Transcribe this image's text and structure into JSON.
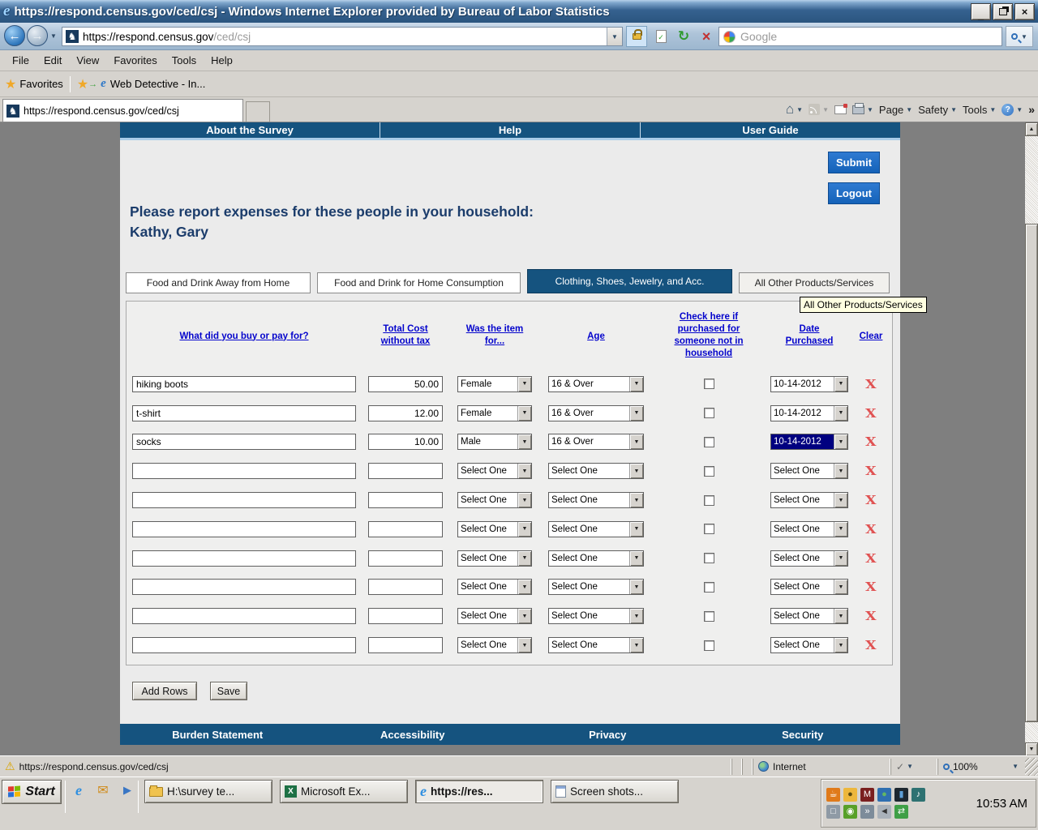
{
  "glyphs": {
    "caret": "▼",
    "up": "▲",
    "back": "←",
    "forward": "→",
    "refresh": "↻",
    "stop": "×",
    "close": "×",
    "minimize": "_",
    "home": "⌂",
    "star": "★",
    "fav_arrow": "→",
    "knight": "♞",
    "warning": "⚠",
    "chevrons": "»",
    "help": "?",
    "check": "✓",
    "clear": "X",
    "ie": "e",
    "excel_x": "X"
  },
  "browser": {
    "title": "https://respond.census.gov/ced/csj - Windows Internet Explorer provided by Bureau of Labor Statistics",
    "url_domain": "https://respond.census.gov",
    "url_path": "/ced/csj",
    "search_placeholder": "Google",
    "menu": [
      "File",
      "Edit",
      "View",
      "Favorites",
      "Tools",
      "Help"
    ],
    "favorites_button": "Favorites",
    "favorites_item": "Web Detective - In...",
    "tab_title": "https://respond.census.gov/ced/csj",
    "command_bar": {
      "page": "Page",
      "safety": "Safety",
      "tools": "Tools"
    }
  },
  "page": {
    "nav_links": [
      "About the Survey",
      "Help",
      "User Guide"
    ],
    "submit": "Submit",
    "logout": "Logout",
    "heading1": "Please report expenses for these people in your household:",
    "heading2": "Kathy, Gary",
    "category_tabs": [
      {
        "label": "Food and Drink Away from Home",
        "active": false
      },
      {
        "label": "Food and Drink for Home Consumption",
        "active": false
      },
      {
        "label": "Clothing, Shoes, Jewelry, and Acc.",
        "active": true
      },
      {
        "label": "All Other Products/Services",
        "active": false
      }
    ],
    "tooltip": "All Other Products/Services",
    "table": {
      "headers": [
        "What did you buy or pay for?",
        "Total Cost without tax",
        "Was the item for...",
        "Age",
        "Check here if purchased for someone not in household",
        "Date Purchased",
        "Clear"
      ],
      "rows": [
        {
          "item": "hiking boots",
          "cost": "50.00",
          "item_for": "Female",
          "age": "16 & Over",
          "not_in_household": false,
          "date": "10-14-2012",
          "date_highlighted": false
        },
        {
          "item": "t-shirt",
          "cost": "12.00",
          "item_for": "Female",
          "age": "16 & Over",
          "not_in_household": false,
          "date": "10-14-2012",
          "date_highlighted": false
        },
        {
          "item": "socks",
          "cost": "10.00",
          "item_for": "Male",
          "age": "16 & Over",
          "not_in_household": false,
          "date": "10-14-2012",
          "date_highlighted": true
        },
        {
          "item": "",
          "cost": "",
          "item_for": "Select One",
          "age": "Select One",
          "not_in_household": false,
          "date": "Select One",
          "date_highlighted": false
        },
        {
          "item": "",
          "cost": "",
          "item_for": "Select One",
          "age": "Select One",
          "not_in_household": false,
          "date": "Select One",
          "date_highlighted": false
        },
        {
          "item": "",
          "cost": "",
          "item_for": "Select One",
          "age": "Select One",
          "not_in_household": false,
          "date": "Select One",
          "date_highlighted": false
        },
        {
          "item": "",
          "cost": "",
          "item_for": "Select One",
          "age": "Select One",
          "not_in_household": false,
          "date": "Select One",
          "date_highlighted": false
        },
        {
          "item": "",
          "cost": "",
          "item_for": "Select One",
          "age": "Select One",
          "not_in_household": false,
          "date": "Select One",
          "date_highlighted": false
        },
        {
          "item": "",
          "cost": "",
          "item_for": "Select One",
          "age": "Select One",
          "not_in_household": false,
          "date": "Select One",
          "date_highlighted": false
        },
        {
          "item": "",
          "cost": "",
          "item_for": "Select One",
          "age": "Select One",
          "not_in_household": false,
          "date": "Select One",
          "date_highlighted": false
        }
      ]
    },
    "add_rows": "Add Rows",
    "save": "Save",
    "footer_links": [
      "Burden Statement",
      "Accessibility",
      "Privacy",
      "Security"
    ]
  },
  "status_bar": {
    "url": "https://respond.census.gov/ced/csj",
    "zone": "Internet",
    "zoom_level": "100%"
  },
  "taskbar": {
    "start": "Start",
    "window_buttons": [
      {
        "label": "H:\\survey te...",
        "icon": "folder",
        "active": false
      },
      {
        "label": "Microsoft Ex...",
        "icon": "excel",
        "active": false
      },
      {
        "label": "https://res...",
        "icon": "ie",
        "active": true
      },
      {
        "label": "Screen shots...",
        "icon": "doc",
        "active": false
      }
    ],
    "clock": "10:53 AM",
    "tray_icons": [
      {
        "name": "java-tray",
        "glyph": "☕",
        "bg": "#e07a1a",
        "fg": "#ffffff"
      },
      {
        "name": "security-lock-tray",
        "glyph": "●",
        "bg": "#edb73c",
        "fg": "#5a4a10"
      },
      {
        "name": "mcafee-tray",
        "glyph": "M",
        "bg": "#7a1f1f",
        "fg": "#ffffff"
      },
      {
        "name": "network-globe-tray",
        "glyph": "●",
        "bg": "#2f6fb0",
        "fg": "#63b763"
      },
      {
        "name": "device-tray",
        "glyph": "▮",
        "bg": "#1d2730",
        "fg": "#5e9fd8"
      },
      {
        "name": "media-player-tray",
        "glyph": "♪",
        "bg": "#2e7272",
        "fg": "#ffffff"
      },
      {
        "name": "display-settings-tray",
        "glyph": "□",
        "bg": "#8f9aa5",
        "fg": "#ffffff"
      },
      {
        "name": "nvidia-tray",
        "glyph": "◉",
        "bg": "#58a028",
        "fg": "#ffffff"
      },
      {
        "name": "remote-display-tray",
        "glyph": "»",
        "bg": "#7d8c9a",
        "fg": "#ffffff"
      },
      {
        "name": "volume-tray",
        "glyph": "◄",
        "bg": "#aab2ba",
        "fg": "#333333"
      },
      {
        "name": "sync-tray",
        "glyph": "⇄",
        "bg": "#3f9f46",
        "fg": "#ffffff"
      }
    ]
  },
  "colors": {
    "navy": "#15537f",
    "button_blue": "#1462b8",
    "link_blue": "#0404cc",
    "clear_red": "#e05252",
    "tooltip_bg": "#ffffe1"
  }
}
